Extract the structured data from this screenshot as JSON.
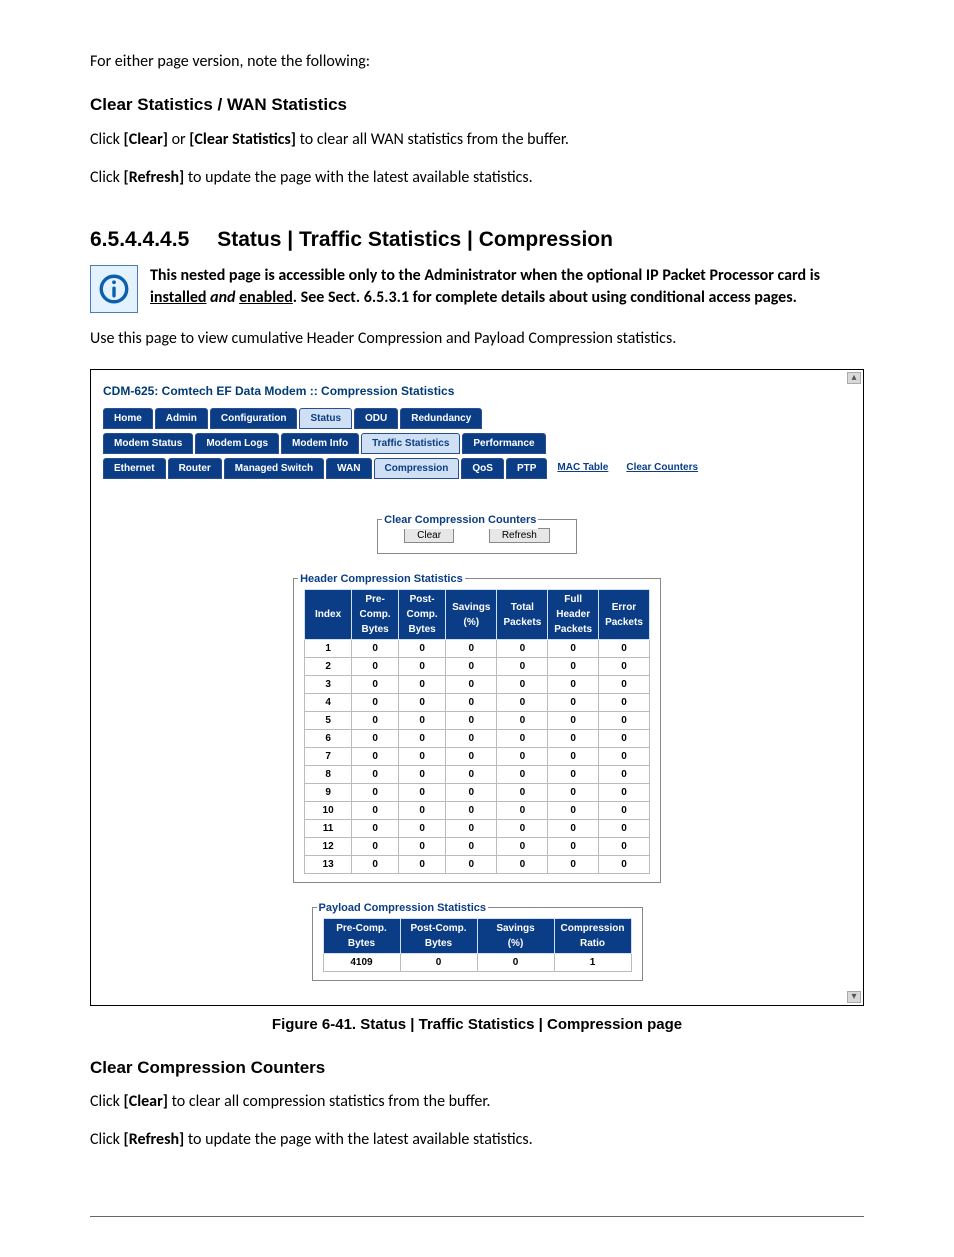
{
  "top": {
    "intro": "For either page version, note the following:",
    "h1": "Clear Statistics / WAN Statistics",
    "p1a": "Click ",
    "p1b": "[Clear]",
    "p1c": " or ",
    "p1d": "[Clear Statistics]",
    "p1e": " to clear all WAN statistics from the buffer.",
    "p2a": "Click ",
    "p2b": "[Refresh]",
    "p2c": " to update the page with the latest available statistics."
  },
  "section": {
    "num": "6.5.4.4.4.5",
    "title": "Status | Traffic Statistics | Compression",
    "note_a": "This nested page is accessible only to the Administrator when the optional IP Packet Processor card is ",
    "note_u1": "installed",
    "note_and": " and ",
    "note_u2": "enabled",
    "note_b": ". See Sect. 6.5.3.1 for complete details about using conditional access pages.",
    "intro": "Use this page to view cumulative Header Compression and Payload Compression statistics."
  },
  "shot": {
    "title": "CDM-625: Comtech EF Data Modem :: Compression Statistics",
    "tabs1": [
      {
        "label": "Home",
        "sel": false
      },
      {
        "label": "Admin",
        "sel": false
      },
      {
        "label": "Configuration",
        "sel": false
      },
      {
        "label": "Status",
        "sel": true
      },
      {
        "label": "ODU",
        "sel": false
      },
      {
        "label": "Redundancy",
        "sel": false
      }
    ],
    "tabs2": [
      {
        "label": "Modem Status",
        "sel": false
      },
      {
        "label": "Modem Logs",
        "sel": false
      },
      {
        "label": "Modem Info",
        "sel": false
      },
      {
        "label": "Traffic Statistics",
        "sel": true
      },
      {
        "label": "Performance",
        "sel": false
      }
    ],
    "tabs3": [
      {
        "label": "Ethernet",
        "sel": false
      },
      {
        "label": "Router",
        "sel": false
      },
      {
        "label": "Managed Switch",
        "sel": false
      },
      {
        "label": "WAN",
        "sel": false
      },
      {
        "label": "Compression",
        "sel": true
      },
      {
        "label": "QoS",
        "sel": false
      },
      {
        "label": "PTP",
        "sel": false
      },
      {
        "label": "MAC Table",
        "sel": false,
        "link": true
      },
      {
        "label": "Clear Counters",
        "sel": false,
        "link": true
      }
    ],
    "fs1": {
      "legend": "Clear Compression Counters",
      "clear": "Clear",
      "refresh": "Refresh"
    },
    "fs2": {
      "legend": "Header Compression Statistics",
      "headers": [
        "Index",
        "Pre-Comp. Bytes",
        "Post-Comp. Bytes",
        "Savings (%)",
        "Total Packets",
        "Full Header Packets",
        "Error Packets"
      ],
      "rows": [
        [
          "1",
          "0",
          "0",
          "0",
          "0",
          "0",
          "0"
        ],
        [
          "2",
          "0",
          "0",
          "0",
          "0",
          "0",
          "0"
        ],
        [
          "3",
          "0",
          "0",
          "0",
          "0",
          "0",
          "0"
        ],
        [
          "4",
          "0",
          "0",
          "0",
          "0",
          "0",
          "0"
        ],
        [
          "5",
          "0",
          "0",
          "0",
          "0",
          "0",
          "0"
        ],
        [
          "6",
          "0",
          "0",
          "0",
          "0",
          "0",
          "0"
        ],
        [
          "7",
          "0",
          "0",
          "0",
          "0",
          "0",
          "0"
        ],
        [
          "8",
          "0",
          "0",
          "0",
          "0",
          "0",
          "0"
        ],
        [
          "9",
          "0",
          "0",
          "0",
          "0",
          "0",
          "0"
        ],
        [
          "10",
          "0",
          "0",
          "0",
          "0",
          "0",
          "0"
        ],
        [
          "11",
          "0",
          "0",
          "0",
          "0",
          "0",
          "0"
        ],
        [
          "12",
          "0",
          "0",
          "0",
          "0",
          "0",
          "0"
        ],
        [
          "13",
          "0",
          "0",
          "0",
          "0",
          "0",
          "0"
        ]
      ]
    },
    "fs3": {
      "legend": "Payload Compression Statistics",
      "headers": [
        "Pre-Comp. Bytes",
        "Post-Comp. Bytes",
        "Savings (%)",
        "Compression Ratio"
      ],
      "row": [
        "4109",
        "0",
        "0",
        "1"
      ]
    }
  },
  "caption": "Figure 6-41. Status | Traffic Statistics | Compression page",
  "bottom": {
    "h": "Clear Compression Counters",
    "p1a": "Click ",
    "p1b": "[Clear]",
    "p1c": " to clear all compression statistics from the buffer.",
    "p2a": "Click ",
    "p2b": "[Refresh]",
    "p2c": " to update the page with the latest available statistics."
  }
}
